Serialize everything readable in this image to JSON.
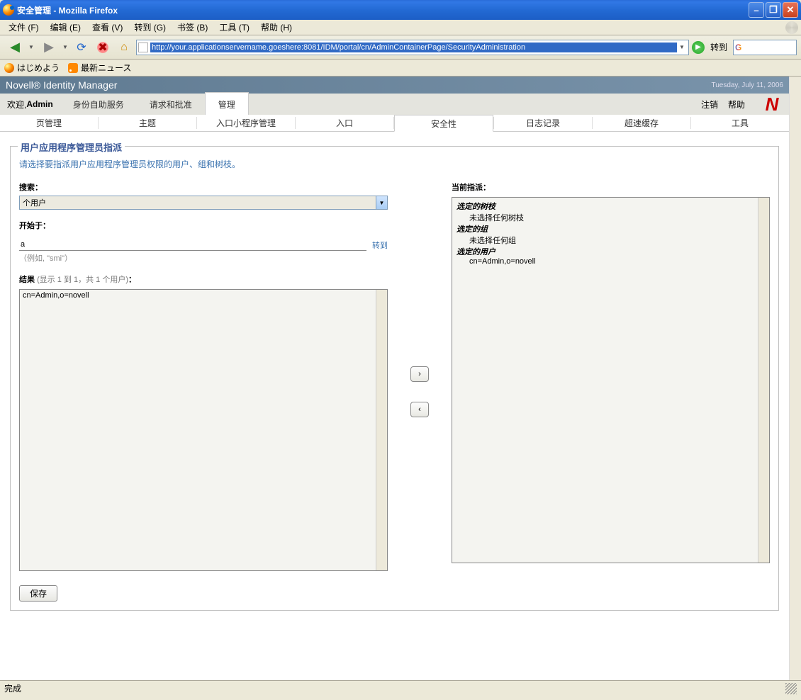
{
  "window": {
    "title": "安全管理 - Mozilla Firefox"
  },
  "menubar": {
    "file": "文件 (F)",
    "edit": "编辑 (E)",
    "view": "查看 (V)",
    "go": "转到 (G)",
    "bookmarks": "书签 (B)",
    "tools": "工具 (T)",
    "help": "帮助 (H)"
  },
  "toolbar": {
    "url": "http://your.applicationservername.goeshere:8081/IDM/portal/cn/AdminContainerPage/SecurityAdministration",
    "go_label": "转到"
  },
  "bookmarks": {
    "first": "はじめよう",
    "news": "最新ニュース"
  },
  "novell": {
    "brand": "Novell® Identity Manager",
    "date": "Tuesday, July 11, 2006",
    "welcome_prefix": "欢迎, ",
    "welcome_user": "Admin",
    "logout": "注销",
    "help": "帮助",
    "logo": "N"
  },
  "tabs": {
    "self_service": "身份自助服务",
    "requests": "请求和批准",
    "admin": "管理"
  },
  "subnav": {
    "page_mgmt": "页管理",
    "theme": "主题",
    "portlet_mgmt": "入口小程序管理",
    "portal": "入口",
    "security": "安全性",
    "logging": "日志记录",
    "cache": "超速缓存",
    "tools": "工具"
  },
  "panel": {
    "legend": "用户应用程序管理员指派",
    "instruction": "请选择要指派用户应用程序管理员权限的用户、组和树枝。",
    "search_label": "搜索：",
    "search_select_value": "个用户",
    "starts_with_label": "开始于：",
    "starts_with_value": "a",
    "go_link": "转到",
    "example_hint": "（例如, \"smi\"）",
    "results_label": "结果",
    "results_count": "(显示 1 到 1，共 1 个用户)",
    "results_colon": "：",
    "result_item": "cn=Admin,o=novell",
    "current_label": "当前指派：",
    "selected_tree": "选定的树枝",
    "selected_tree_none": "未选择任何树枝",
    "selected_group": "选定的组",
    "selected_group_none": "未选择任何组",
    "selected_user": "选定的用户",
    "selected_user_val": "cn=Admin,o=novell",
    "save": "保存",
    "arrow_right": "›",
    "arrow_left": "‹"
  },
  "statusbar": {
    "text": "完成"
  }
}
